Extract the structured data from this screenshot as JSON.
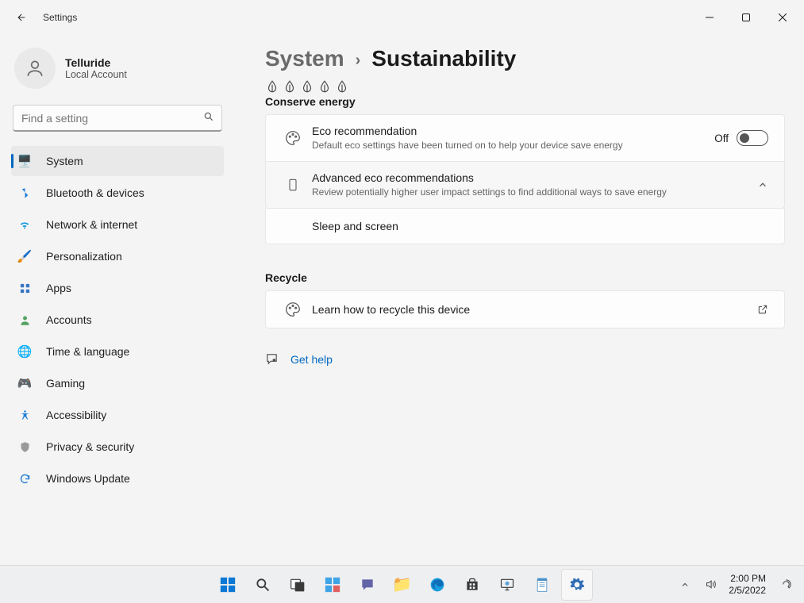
{
  "window": {
    "title": "Settings"
  },
  "user": {
    "name": "Telluride",
    "sub": "Local Account"
  },
  "search": {
    "placeholder": "Find a setting"
  },
  "nav": {
    "items": [
      {
        "label": "System",
        "selected": true
      },
      {
        "label": "Bluetooth & devices"
      },
      {
        "label": "Network & internet"
      },
      {
        "label": "Personalization"
      },
      {
        "label": "Apps"
      },
      {
        "label": "Accounts"
      },
      {
        "label": "Time & language"
      },
      {
        "label": "Gaming"
      },
      {
        "label": "Accessibility"
      },
      {
        "label": "Privacy & security"
      },
      {
        "label": "Windows Update"
      }
    ]
  },
  "breadcrumb": {
    "root": "System",
    "page": "Sustainability"
  },
  "sections": {
    "conserve": {
      "label": "Conserve energy",
      "eco": {
        "title": "Eco recommendation",
        "sub": "Default eco settings have been turned on to help your device save energy",
        "toggle": "Off"
      },
      "advanced": {
        "title": "Advanced eco recommendations",
        "sub": "Review potentially higher user impact settings to find additional ways to save energy",
        "child1": "Sleep and screen"
      }
    },
    "recycle": {
      "label": "Recycle",
      "learn": {
        "title": "Learn how to recycle this device"
      }
    },
    "help": {
      "label": "Get help"
    }
  },
  "tray": {
    "time": "2:00 PM",
    "date": "2/5/2022"
  }
}
